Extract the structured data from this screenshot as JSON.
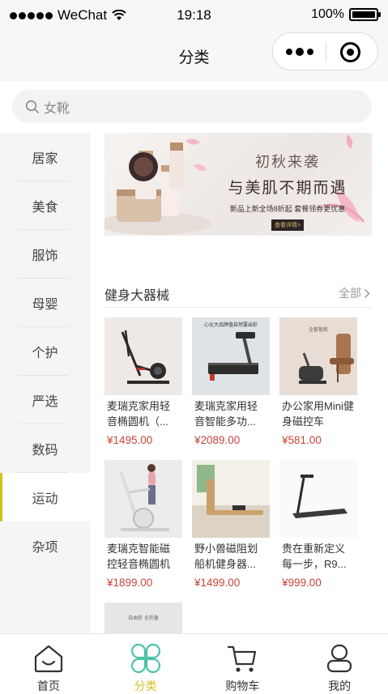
{
  "status_bar": {
    "carrier": "WeChat",
    "time": "19:18",
    "battery": "100%",
    "battery_level": 1.0
  },
  "nav": {
    "title": "分类"
  },
  "search": {
    "placeholder": "女靴"
  },
  "categories": [
    {
      "label": "居家"
    },
    {
      "label": "美食"
    },
    {
      "label": "服饰"
    },
    {
      "label": "母婴"
    },
    {
      "label": "个护"
    },
    {
      "label": "严选"
    },
    {
      "label": "数码"
    },
    {
      "label": "运动",
      "active": true
    },
    {
      "label": "杂项"
    }
  ],
  "banner": {
    "line1": "初秋来袭",
    "line2": "与美肌不期而遇",
    "line3": "新品上新全场8折起 套餐领券更优惠",
    "button": "查看详情>"
  },
  "section": {
    "title": "健身大器械",
    "more": "全部"
  },
  "products": [
    {
      "name": "麦瑞克家用轻音椭圆机（...",
      "price": "¥1495.00",
      "image": "elliptical-trainer"
    },
    {
      "name": "麦瑞克家用轻音智能多功...",
      "price": "¥2089.00",
      "image": "treadmill",
      "image_caption": "心仪大品牌值自然要出彩"
    },
    {
      "name": "办公家用Mini健身磁控车",
      "price": "¥581.00",
      "image": "mini-bike",
      "image_caption": "全套锻炼"
    },
    {
      "name": "麦瑞克智能磁控轻音椭圆机",
      "price": "¥1899.00",
      "image": "elliptical-woman"
    },
    {
      "name": "野小兽磁阻划船机健身器...",
      "price": "¥1499.00",
      "image": "rowing-machine"
    },
    {
      "name": "贵在重新定义每一步，R9...",
      "price": "¥999.00",
      "image": "walking-pad"
    },
    {
      "name": "",
      "price": "",
      "image": "partial-product",
      "image_caption": "自由折 全折叠"
    }
  ],
  "tabs": [
    {
      "label": "首页",
      "icon": "home-icon"
    },
    {
      "label": "分类",
      "icon": "category-icon",
      "active": true
    },
    {
      "label": "购物车",
      "icon": "cart-icon"
    },
    {
      "label": "我的",
      "icon": "profile-icon"
    }
  ],
  "colors": {
    "accent": "#d4c21a",
    "price": "#c8443c",
    "tab_active_icon": "#4dc2a8"
  }
}
